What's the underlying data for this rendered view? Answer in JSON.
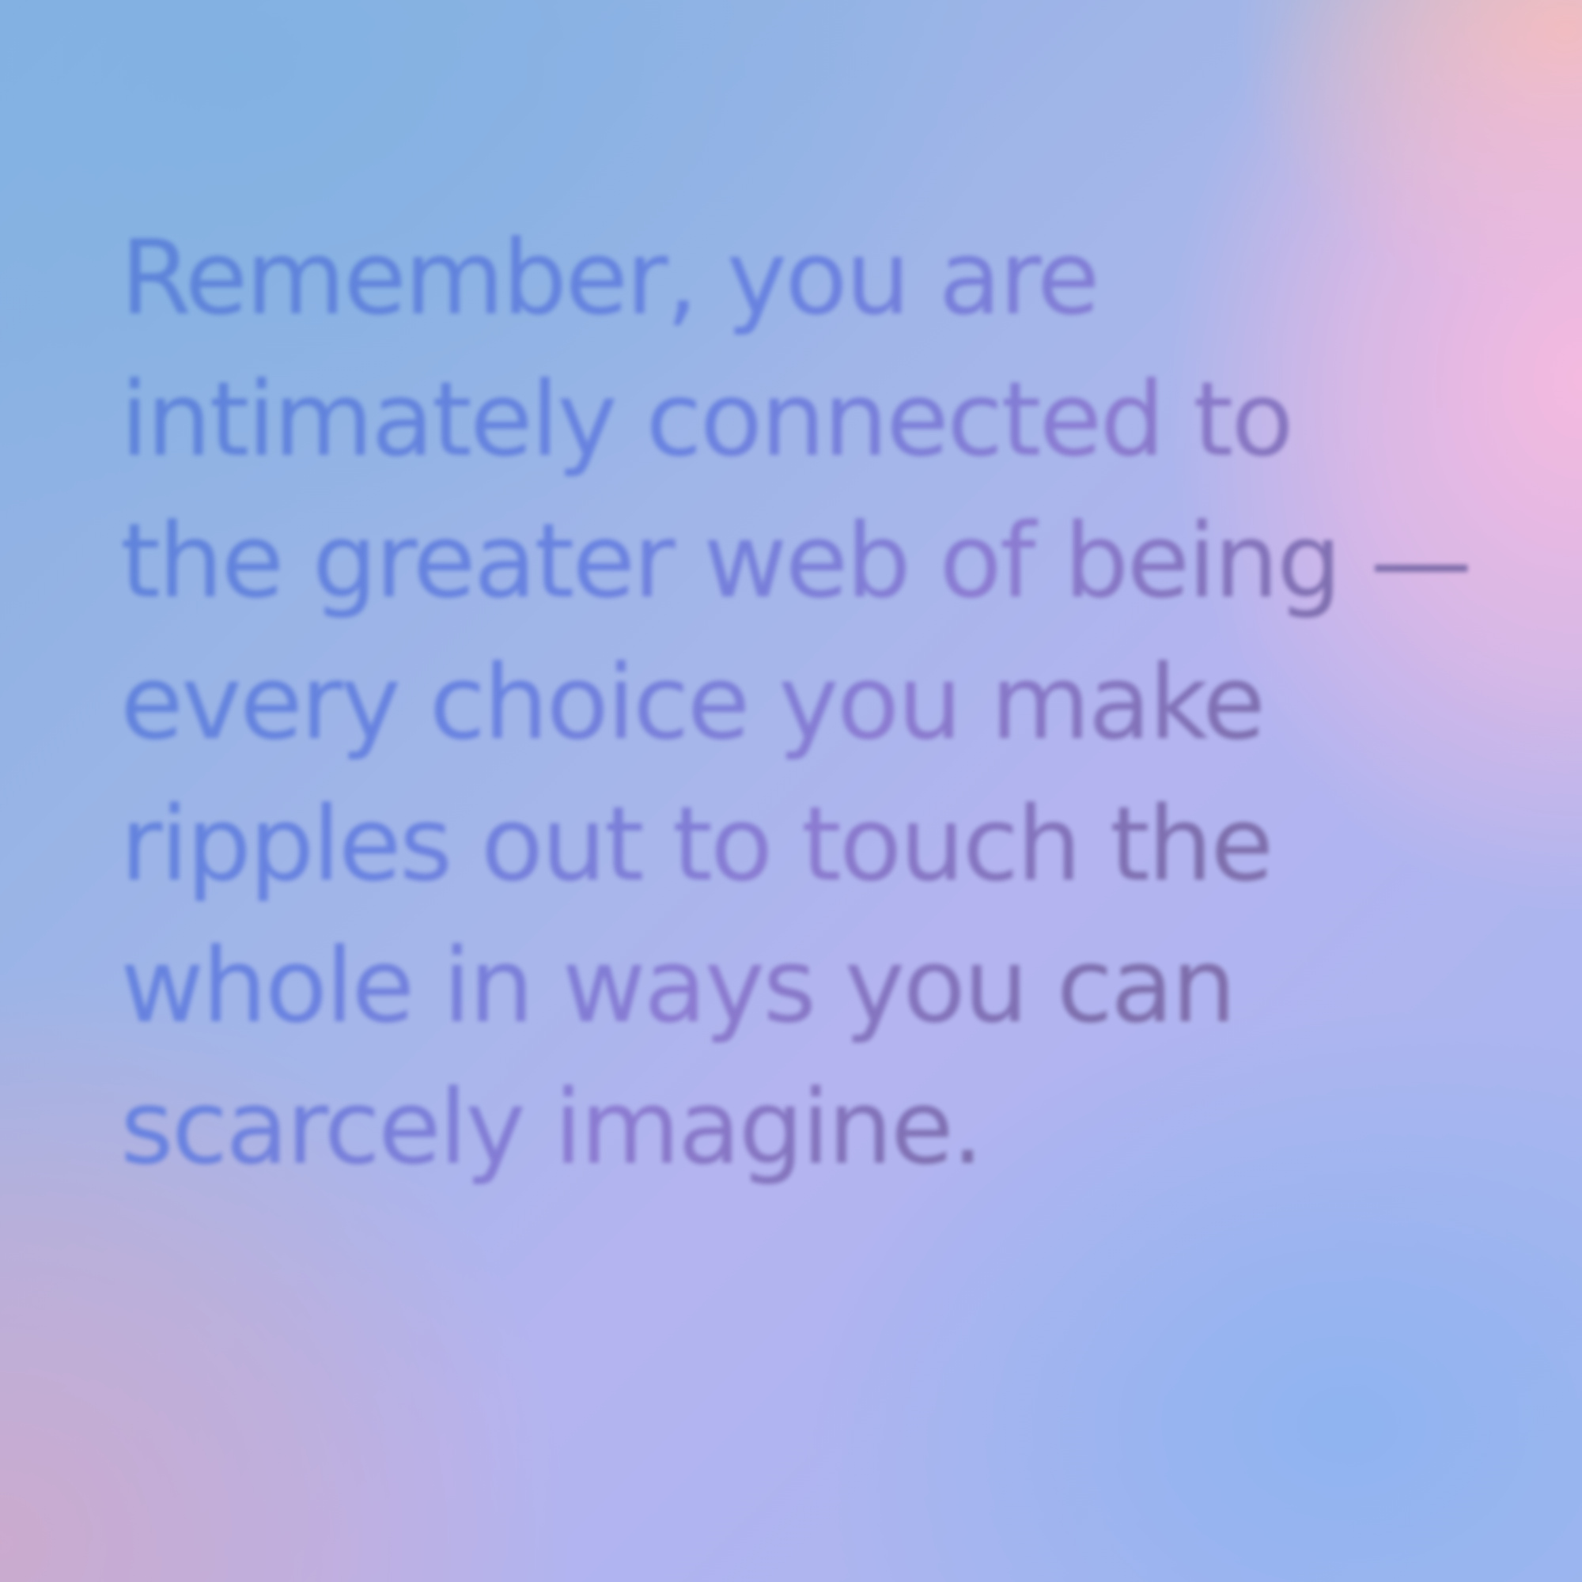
{
  "quote": {
    "text": "Remember, you are intimately connected to the greater web of being — every choice you make ripples out to touch the whole in ways you can scarcely imagine."
  },
  "colors": {
    "text_start": "#5a82d8",
    "text_mid": "#8a78d0",
    "text_end": "#7a6aa8",
    "bg_blue": "#84b0e0",
    "bg_pink": "#f8bade",
    "bg_peach": "#f4c0a8",
    "bg_mauve": "#cdaacd"
  }
}
